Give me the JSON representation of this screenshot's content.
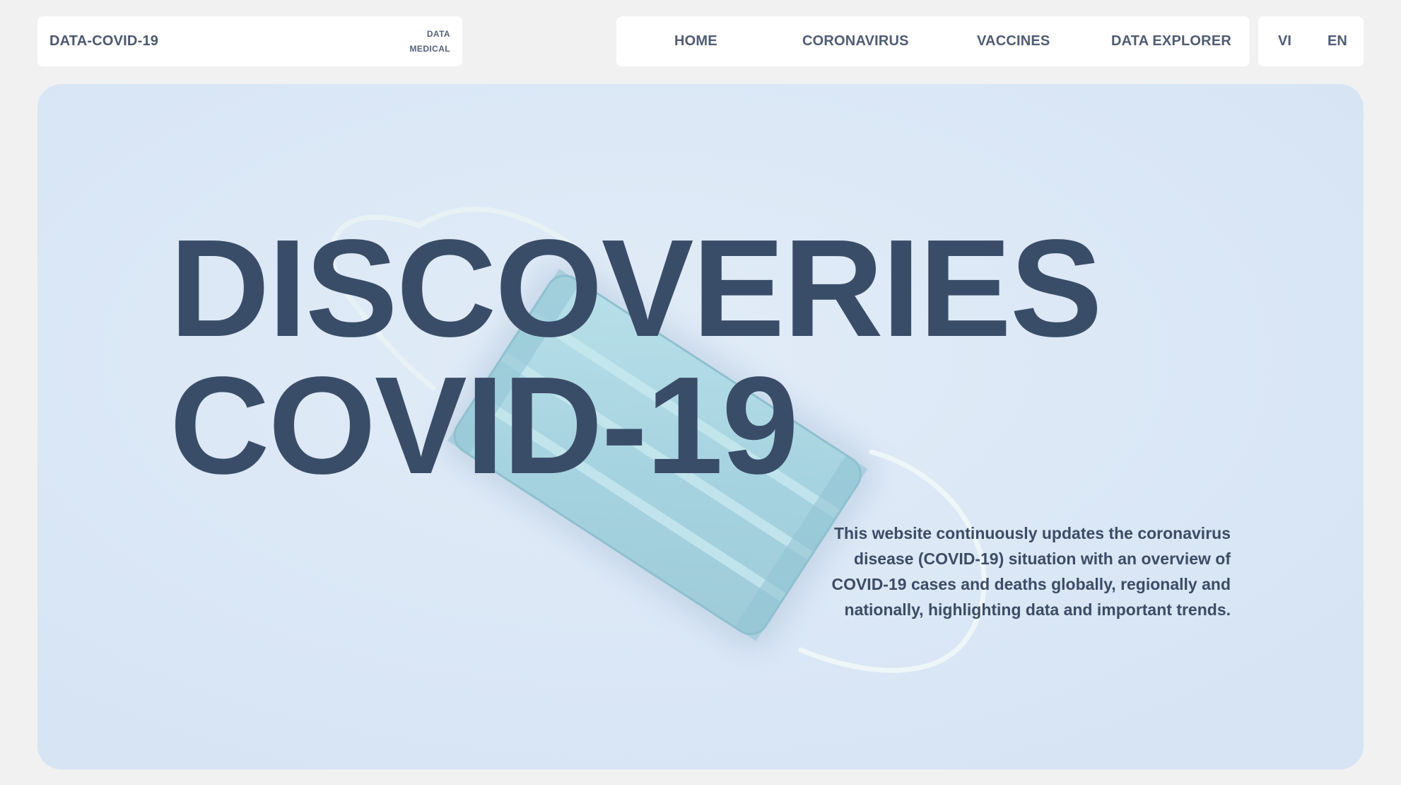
{
  "brand": {
    "title": "DATA-COVID-19",
    "tag_line_1": "DATA",
    "tag_line_2": "MEDICAL"
  },
  "nav": {
    "items": [
      {
        "label": "HOME"
      },
      {
        "label": "CORONAVIRUS"
      },
      {
        "label": "VACCINES"
      },
      {
        "label": "DATA EXPLORER"
      }
    ]
  },
  "language": {
    "options": [
      {
        "label": "VI"
      },
      {
        "label": "EN"
      }
    ]
  },
  "hero": {
    "title_line_1": "DISCOVERIES",
    "title_line_2": "COVID-19",
    "description": "This website continuously updates the coronavirus disease (COVID-19) situation with an overview of COVID-19 cases and deaths globally, regionally and nationally, highlighting data and important trends.",
    "image_icon": "face-mask-icon"
  },
  "colors": {
    "page_background": "#f1f1f1",
    "card_background": "#ffffff",
    "hero_background": "#d8e6f5",
    "text_primary": "#3a4d68",
    "mask": "#a9d6e2"
  }
}
